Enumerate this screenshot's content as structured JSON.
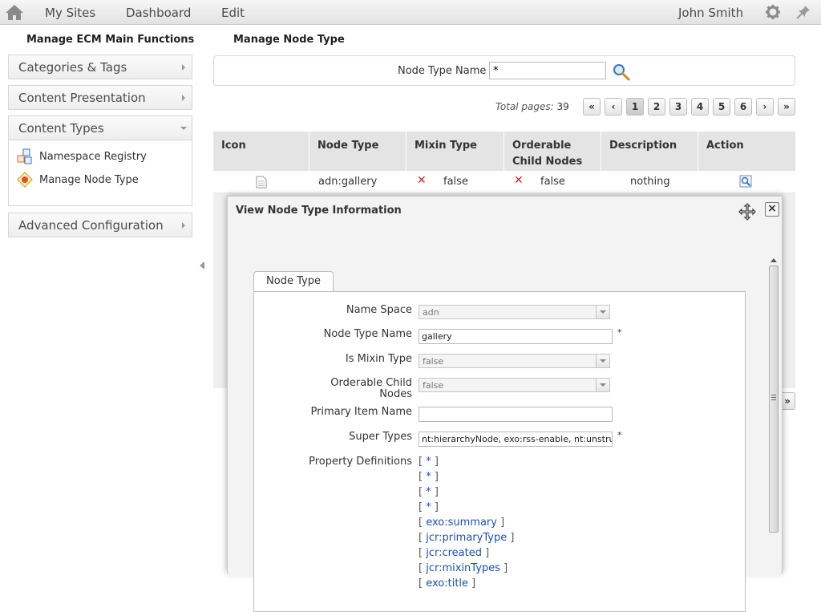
{
  "topbar": {
    "home_icon": "home-icon",
    "nav": [
      "My Sites",
      "Dashboard",
      "Edit"
    ],
    "user": "John Smith"
  },
  "sidebar": {
    "title": "Manage ECM Main Functions",
    "sections": [
      {
        "label": "Categories & Tags",
        "state": "collapsed"
      },
      {
        "label": "Content Presentation",
        "state": "collapsed"
      },
      {
        "label": "Content Types",
        "state": "expanded"
      },
      {
        "label": "Advanced Configuration",
        "state": "collapsed"
      }
    ],
    "content_types_items": [
      {
        "label": "Namespace Registry",
        "icon": "namespace-icon"
      },
      {
        "label": "Manage Node Type",
        "icon": "node-type-icon"
      }
    ]
  },
  "main": {
    "title": "Manage Node Type",
    "search": {
      "label": "Node Type Name",
      "value": "*"
    },
    "pager": {
      "total_label": "Total pages:",
      "total": "39",
      "pages": [
        "1",
        "2",
        "3",
        "4",
        "5",
        "6"
      ],
      "current": "1",
      "first": "«",
      "prev": "‹",
      "next": "›",
      "last": "»"
    },
    "table": {
      "headers": [
        "Icon",
        "Node Type",
        "Mixin Type",
        "Orderable Child Nodes",
        "Description",
        "Action"
      ],
      "rows": [
        {
          "node_type": "adn:gallery",
          "mixin": "false",
          "orderable": "false",
          "description": "nothing"
        }
      ]
    },
    "outer_next": "»"
  },
  "dialog": {
    "title": "View Node Type Information",
    "close": "×",
    "tab": "Node Type",
    "fields": {
      "name_space": {
        "label": "Name Space",
        "value": "adn"
      },
      "node_type_name": {
        "label": "Node Type Name",
        "value": "gallery",
        "required": "*"
      },
      "is_mixin": {
        "label": "Is Mixin Type",
        "value": "false"
      },
      "orderable": {
        "label_1": "Orderable Child",
        "label_2": "Nodes",
        "value": "false"
      },
      "primary_item": {
        "label": "Primary Item Name",
        "value": ""
      },
      "super_types": {
        "label": "Super Types",
        "value": "nt:hierarchyNode, exo:rss-enable, nt:unstructured",
        "required": "*"
      },
      "property_definitions": {
        "label": "Property Definitions",
        "items": [
          "*",
          "*",
          "*",
          "*",
          "exo:summary",
          "jcr:primaryType",
          "jcr:created",
          "jcr:mixinTypes",
          "exo:title"
        ]
      }
    }
  }
}
